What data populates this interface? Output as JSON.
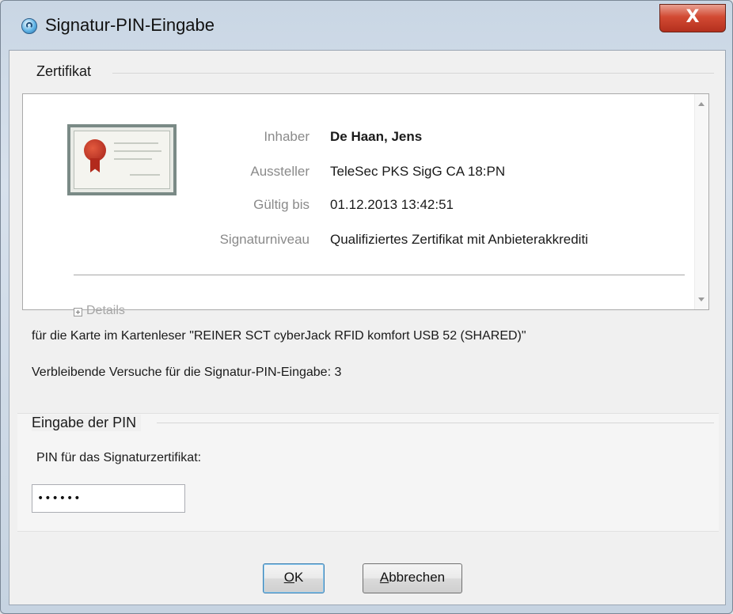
{
  "window": {
    "title": "Signatur-PIN-Eingabe",
    "close_glyph": "X",
    "icon": "signature-app-icon"
  },
  "certificate_group": {
    "label": "Zertifikat",
    "fields": {
      "holder_label": "Inhaber",
      "holder_value": "De Haan, Jens",
      "issuer_label": "Aussteller",
      "issuer_value": "TeleSec PKS SigG CA 18:PN",
      "valid_label": "Gültig bis",
      "valid_value": "01.12.2013 13:42:51",
      "level_label": "Signaturniveau",
      "level_value": "Qualifiziertes Zertifikat mit Anbieterakkrediti"
    },
    "details_label": "Details"
  },
  "info": {
    "card_reader": "für die Karte im Kartenleser \"REINER SCT cyberJack RFID komfort USB 52 (SHARED)\"",
    "attempts": "Verbleibende Versuche für die Signatur-PIN-Eingabe: 3"
  },
  "pin_group": {
    "label": "Eingabe der PIN",
    "field_label": "PIN für das Signaturzertifikat:",
    "value": "••••••"
  },
  "buttons": {
    "ok_mnemonic": "O",
    "ok_rest": "K",
    "cancel_mnemonic": "A",
    "cancel_rest": "bbrechen"
  }
}
